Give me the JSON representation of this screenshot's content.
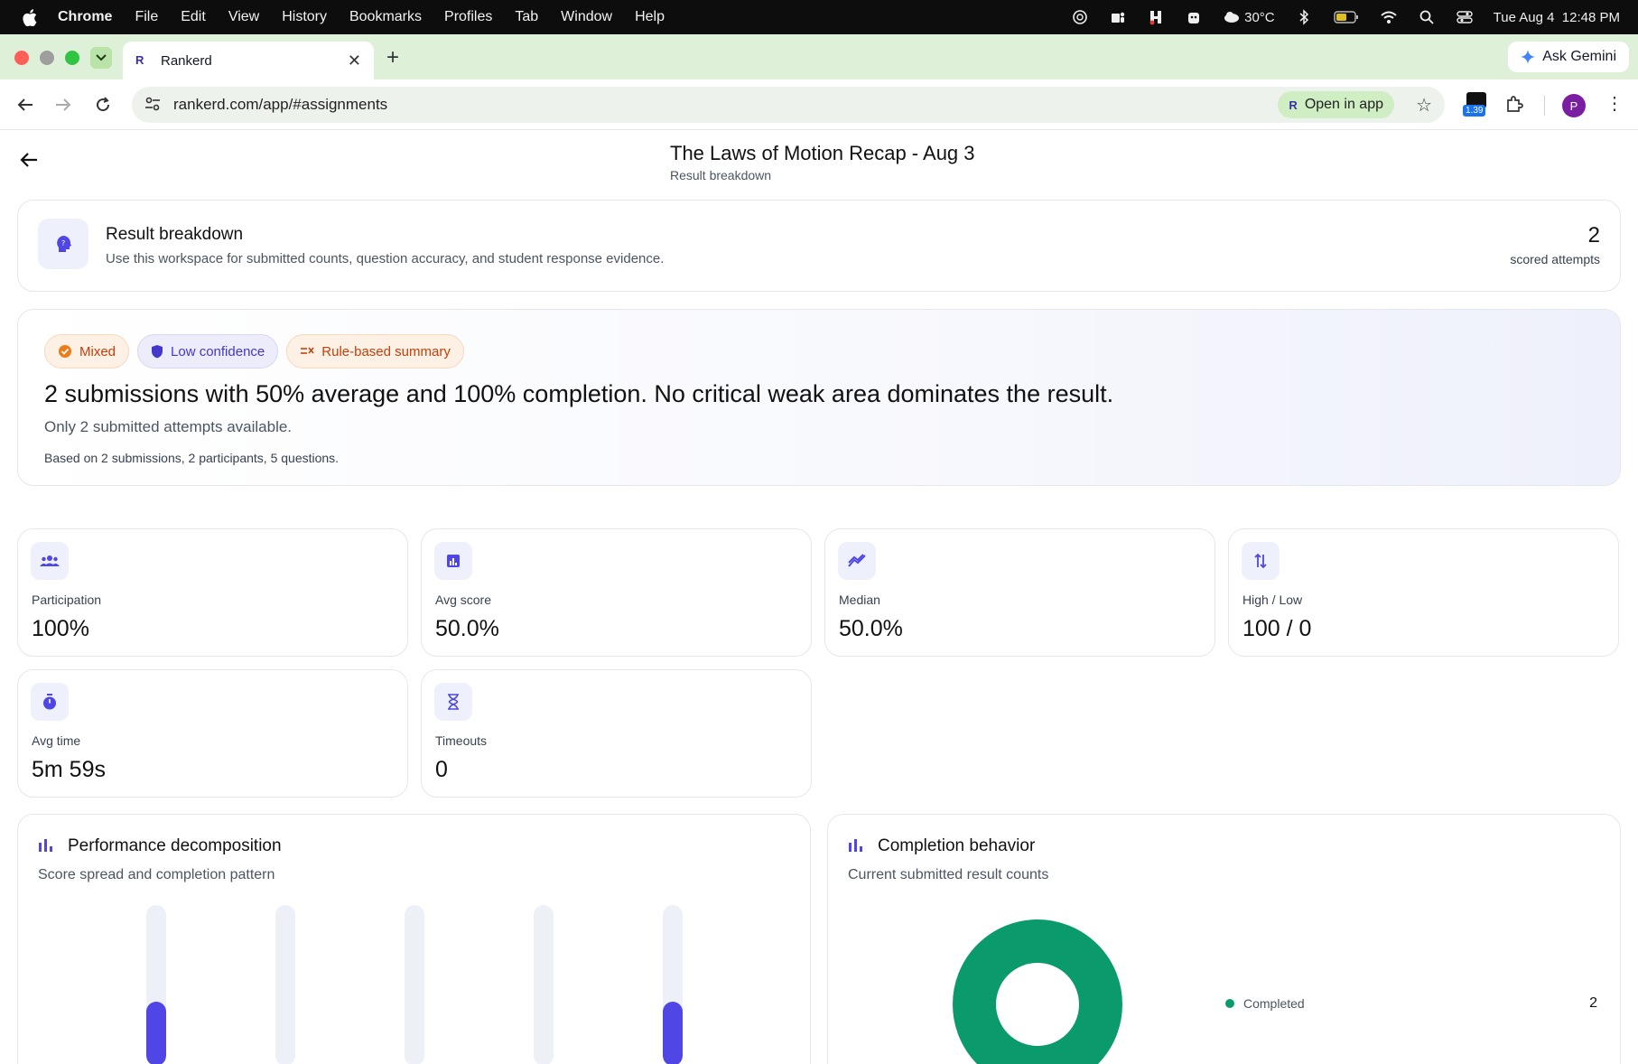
{
  "menubar": {
    "app_name": "Chrome",
    "items": [
      "File",
      "Edit",
      "View",
      "History",
      "Bookmarks",
      "Profiles",
      "Tab",
      "Window",
      "Help"
    ],
    "weather": "30°C",
    "datetime": "Tue Aug 4  12:48 PM"
  },
  "browser": {
    "tab_title": "Rankerd",
    "tab_favicon": "R",
    "ask_gemini": "Ask Gemini",
    "url": "rankerd.com/app/#assignments",
    "open_in_app": "Open in app",
    "extension_badge": "1.39",
    "profile_initial": "P"
  },
  "page": {
    "title": "The Laws of Motion Recap - Aug 3",
    "subtitle": "Result breakdown"
  },
  "result_card": {
    "title": "Result breakdown",
    "description": "Use this workspace for submitted counts, question accuracy, and student response evidence.",
    "count": "2",
    "count_label": "scored attempts"
  },
  "summary": {
    "badges": [
      "Mixed",
      "Low confidence",
      "Rule-based summary"
    ],
    "headline": "2 submissions with 50% average and 100% completion. No critical weak area dominates the result.",
    "note": "Only 2 submitted attempts available.",
    "based_on": "Based on 2 submissions, 2 participants, 5 questions."
  },
  "stats": [
    {
      "label": "Participation",
      "value": "100%",
      "icon": "people-icon"
    },
    {
      "label": "Avg score",
      "value": "50.0%",
      "icon": "bar-chart-icon"
    },
    {
      "label": "Median",
      "value": "50.0%",
      "icon": "trend-icon"
    },
    {
      "label": "High / Low",
      "value": "100 / 0",
      "icon": "swap-vertical-icon"
    },
    {
      "label": "Avg time",
      "value": "5m 59s",
      "icon": "stopwatch-icon"
    },
    {
      "label": "Timeouts",
      "value": "0",
      "icon": "hourglass-icon"
    }
  ],
  "performance": {
    "title": "Performance decomposition",
    "subtitle": "Score spread and completion pattern"
  },
  "completion": {
    "title": "Completion behavior",
    "subtitle": "Current submitted result counts",
    "legend_label": "Completed",
    "legend_count": "2"
  },
  "chart_data": [
    {
      "type": "bar",
      "categories": [
        "",
        "",
        "",
        "",
        ""
      ],
      "values": [
        0.4,
        0,
        0,
        0,
        0.4
      ],
      "ylim": [
        0,
        1
      ],
      "grid": false,
      "legend": "none"
    },
    {
      "type": "pie",
      "categories": [
        "Completed"
      ],
      "values": [
        2
      ],
      "legend": "right"
    }
  ],
  "colors": {
    "accent": "#4f46e5",
    "completed": "#0a9a6b",
    "track": "#eef0f7"
  }
}
